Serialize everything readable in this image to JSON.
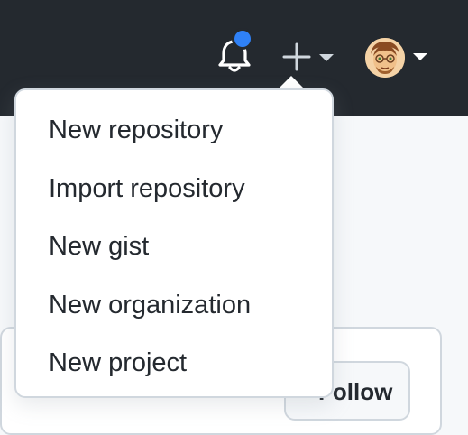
{
  "header": {
    "notifications_icon": "bell-icon",
    "notification_indicator_color": "#2f81f7",
    "create_icon": "plus-icon",
    "avatar_icon": "avatar-image"
  },
  "create_menu": {
    "items": [
      {
        "label": "New repository"
      },
      {
        "label": "Import repository"
      },
      {
        "label": "New gist"
      },
      {
        "label": "New organization"
      },
      {
        "label": "New project"
      }
    ]
  },
  "profile": {
    "follow_label": "Follow"
  }
}
